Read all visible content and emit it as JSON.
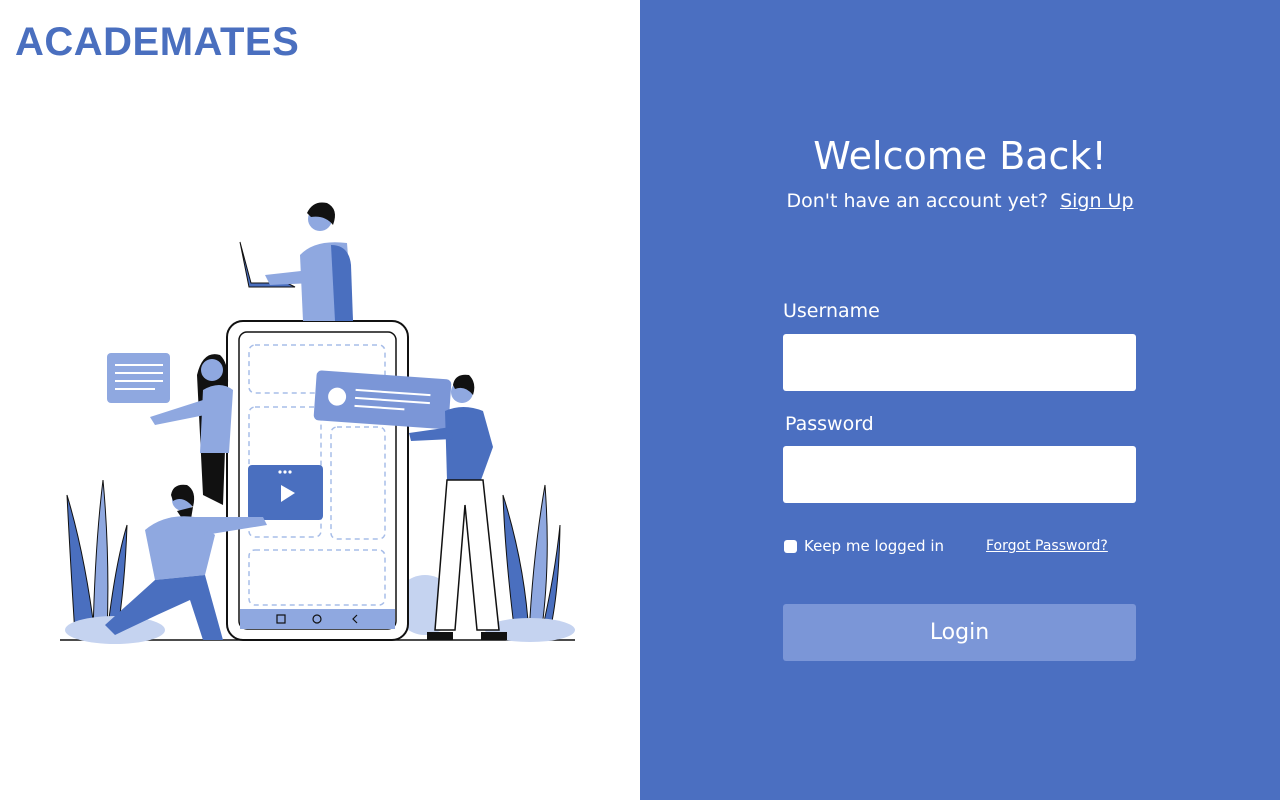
{
  "brand": {
    "name": "ACADEMATES"
  },
  "login": {
    "title": "Welcome Back!",
    "prompt": "Don't have an account yet?",
    "signup_link": "Sign Up",
    "username_label": "Username",
    "username_value": "",
    "password_label": "Password",
    "password_value": "",
    "keep_logged_in_label": "Keep me logged in",
    "keep_logged_in_checked": false,
    "forgot_link": "Forgot Password?",
    "login_button": "Login"
  },
  "colors": {
    "brand": "#4a6fbf",
    "panel": "#4b6fc1",
    "button": "#7b96d7",
    "illustration_dark": "#4a6fbf",
    "illustration_light": "#8fa8e0"
  }
}
